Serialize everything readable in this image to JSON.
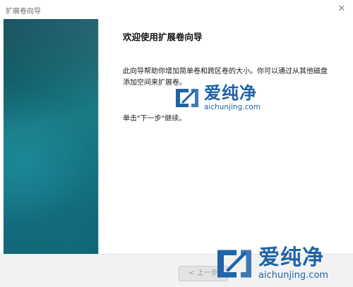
{
  "window": {
    "title": "扩展卷向导",
    "close_glyph": "✕"
  },
  "main": {
    "heading": "欢迎使用扩展卷向导",
    "description": "此向导帮助你增加简单卷和跨区卷的大小。你可以通过从其他磁盘添加空间来扩展卷。",
    "hint": "单击\"下一步\"继续。"
  },
  "footer": {
    "back_label": "< 上一步"
  },
  "watermark": {
    "cn_text": "爱纯净",
    "en_text": "aichunjing.com",
    "color": "#1f63a8",
    "icon": "aichunjing-logo-icon"
  },
  "colors": {
    "banner_dark": "#0c4a57",
    "banner_light": "#1a7b86",
    "footer_bg": "#f2f2f2"
  }
}
